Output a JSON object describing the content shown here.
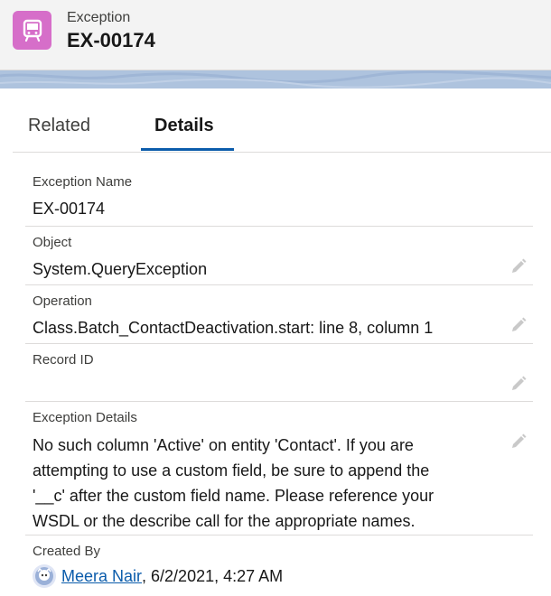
{
  "header": {
    "object_type": "Exception",
    "record_title": "EX-00174",
    "icon": "exception-object-icon",
    "icon_color": "#d66ec9"
  },
  "tabs": [
    {
      "label": "Related",
      "active": false
    },
    {
      "label": "Details",
      "active": true
    }
  ],
  "fields": {
    "exception_name": {
      "label": "Exception Name",
      "value": "EX-00174"
    },
    "object": {
      "label": "Object",
      "value": "System.QueryException"
    },
    "operation": {
      "label": "Operation",
      "value": "Class.Batch_ContactDeactivation.start: line 8, column 1"
    },
    "record_id": {
      "label": "Record ID",
      "value": ""
    },
    "exception_details": {
      "label": "Exception Details",
      "lines": [
        "No such column 'Active' on entity 'Contact'. If you are",
        "attempting to use a custom field, be sure to append the",
        "'__c' after the custom field name. Please reference your",
        "WSDL or the describe call for the appropriate names."
      ]
    },
    "created_by": {
      "label": "Created By",
      "user": "Meera Nair",
      "date": ", 6/2/2021, 4:27 AM"
    }
  },
  "colors": {
    "accent": "#0b5cab",
    "link": "#0b5cab"
  }
}
